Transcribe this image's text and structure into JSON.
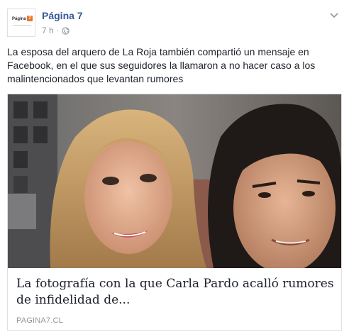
{
  "post": {
    "page_name": "Página 7",
    "time": "7 h",
    "separator": "·",
    "text": "La esposa del arquero de La Roja también compartió un mensaje en Facebook, en el que sus seguidores la llamaron a no hacer caso a los malintencionados que levantan rumores"
  },
  "avatar": {
    "logo_text": "Página",
    "logo_badge": "7"
  },
  "link": {
    "title": "La fotografía con la que Carla Pardo acalló rumores de infidelidad de...",
    "domain": "PAGINA7.CL"
  },
  "icons": {
    "privacy": "globe-icon",
    "menu": "chevron-down-icon"
  },
  "colors": {
    "page_name": "#365899",
    "meta": "#90949c",
    "text": "#1d2129",
    "border": "#dddfe2",
    "logo_accent": "#e8792b"
  }
}
